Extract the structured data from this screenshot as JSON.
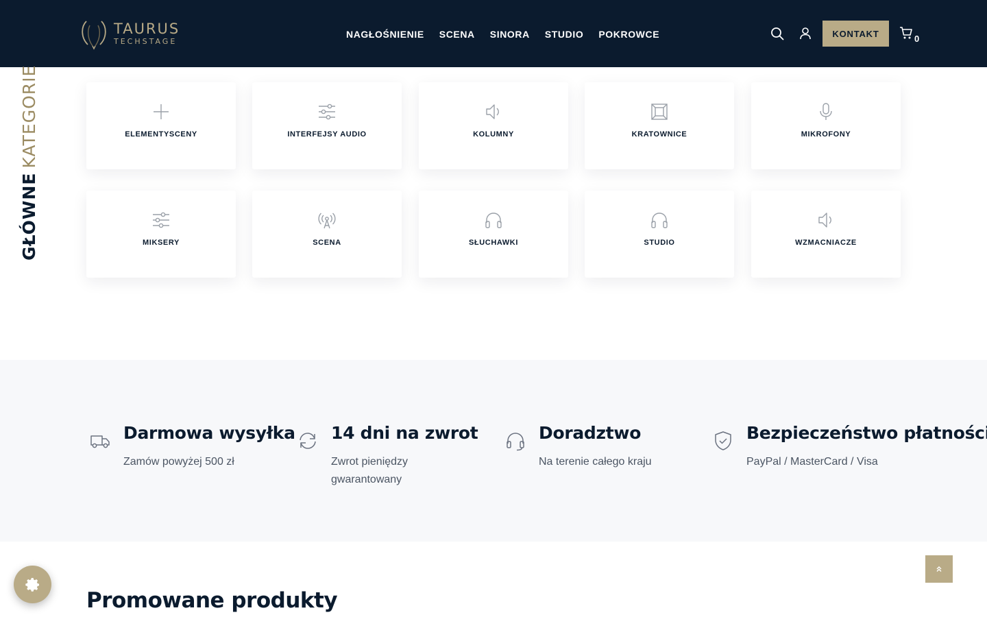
{
  "header": {
    "logo": {
      "line1": "TAURUS",
      "line2": "TECHSTAGE"
    },
    "nav": [
      {
        "label": "NAGŁOŚNIENIE"
      },
      {
        "label": "SCENA"
      },
      {
        "label": "SINORA"
      },
      {
        "label": "STUDIO"
      },
      {
        "label": "POKROWCE"
      }
    ],
    "icons": {
      "search": "search-icon",
      "account": "user-icon",
      "cart": "cart-icon"
    },
    "kontakt_label": "KONTAKT",
    "cart_count": "0"
  },
  "categories_section": {
    "title_bold": "GŁÓWNE",
    "title_light": "KATEGORIE",
    "items": [
      {
        "label": "ELEMENTYSCENY",
        "icon": "plus-icon"
      },
      {
        "label": "INTERFEJSY AUDIO",
        "icon": "sliders-icon"
      },
      {
        "label": "KOLUMNY",
        "icon": "speaker-icon"
      },
      {
        "label": "KRATOWNICE",
        "icon": "truss-frame-icon"
      },
      {
        "label": "MIKROFONY",
        "icon": "microphone-icon"
      },
      {
        "label": "MIKSERY",
        "icon": "mixer-sliders-icon"
      },
      {
        "label": "SCENA",
        "icon": "broadcast-tower-icon"
      },
      {
        "label": "SŁUCHAWKI",
        "icon": "headphones-icon"
      },
      {
        "label": "STUDIO",
        "icon": "headphones-icon"
      },
      {
        "label": "WZMACNIACZE",
        "icon": "speaker-icon"
      }
    ]
  },
  "features": [
    {
      "title": "Darmowa wysyłka",
      "subtitle": "Zamów powyżej 500 zł",
      "icon": "truck-icon"
    },
    {
      "title": "14 dni na zwrot",
      "subtitle": "Zwrot pieniędzy gwarantowany",
      "icon": "refresh-icon"
    },
    {
      "title": "Doradztwo",
      "subtitle": "Na terenie całego kraju",
      "icon": "headset-icon"
    },
    {
      "title": "Bezpieczeństwo płatności",
      "subtitle": "PayPal / MasterCard / Visa",
      "icon": "shield-check-icon"
    }
  ],
  "promo": {
    "title": "Promowane produkty"
  },
  "colors": {
    "header_bg": "#0b1b2e",
    "accent": "#b9ab87",
    "features_bg": "#f7f8fa"
  }
}
